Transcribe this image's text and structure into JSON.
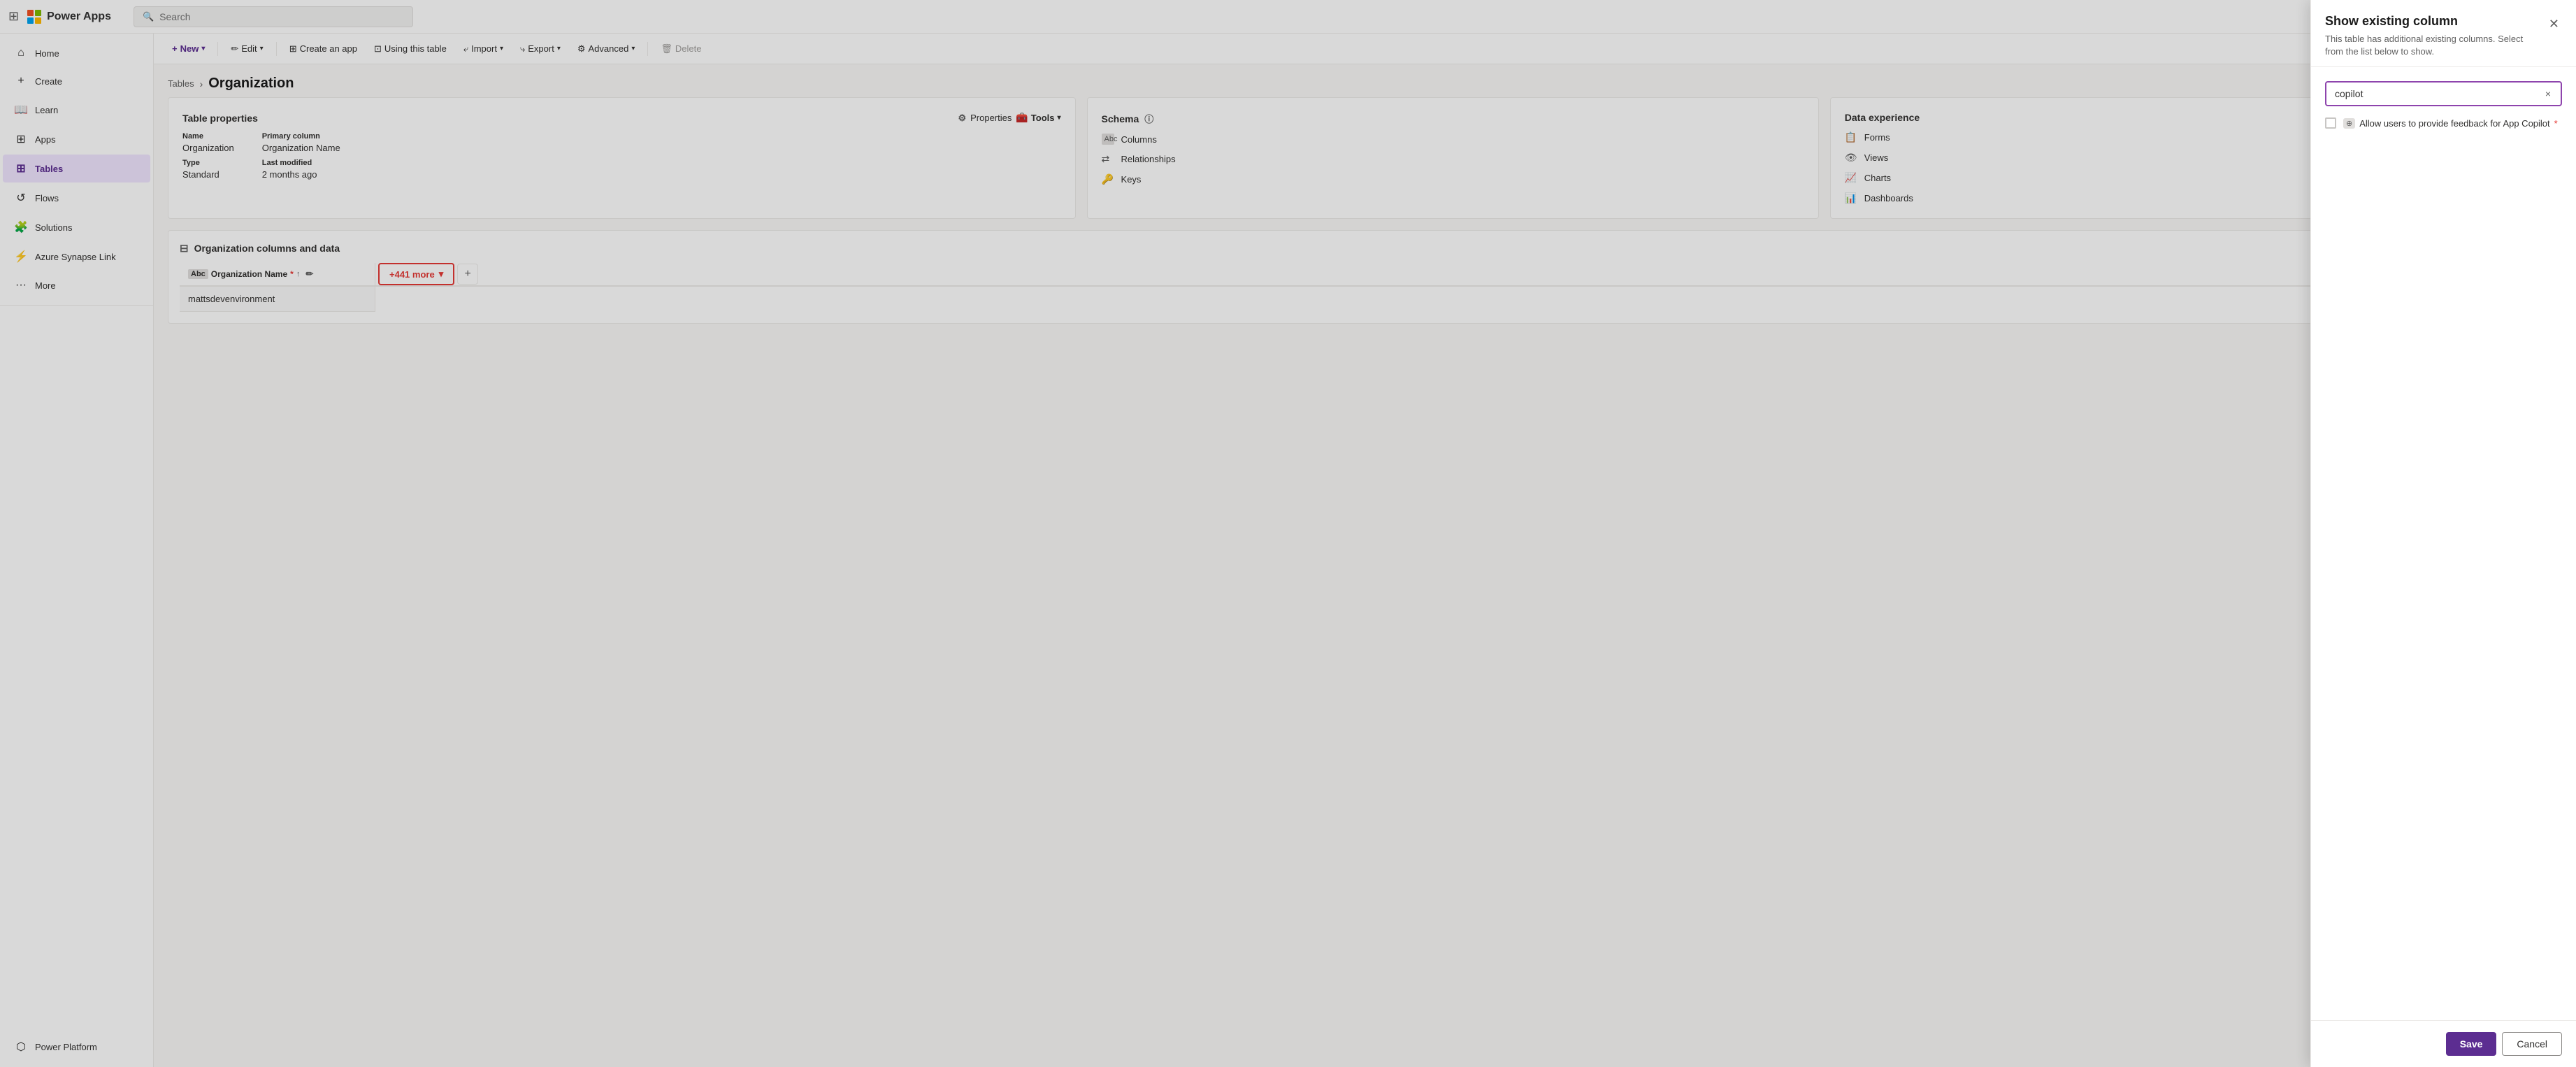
{
  "app": {
    "brand": "Power Apps",
    "search_placeholder": "Search"
  },
  "nav": {
    "items": [
      {
        "id": "home",
        "label": "Home",
        "icon": "⌂"
      },
      {
        "id": "create",
        "label": "Create",
        "icon": "+"
      },
      {
        "id": "learn",
        "label": "Learn",
        "icon": "📖"
      },
      {
        "id": "apps",
        "label": "Apps",
        "icon": "⊞"
      },
      {
        "id": "tables",
        "label": "Tables",
        "icon": "⊞",
        "active": true
      },
      {
        "id": "flows",
        "label": "Flows",
        "icon": "↺"
      },
      {
        "id": "solutions",
        "label": "Solutions",
        "icon": "🧩"
      },
      {
        "id": "azure-synapse",
        "label": "Azure Synapse Link",
        "icon": "⚡"
      },
      {
        "id": "more",
        "label": "More",
        "icon": "···"
      },
      {
        "id": "power-platform",
        "label": "Power Platform",
        "icon": "⬡"
      }
    ]
  },
  "toolbar": {
    "new_label": "New",
    "edit_label": "Edit",
    "create_app_label": "Create an app",
    "using_this_table_label": "Using this table",
    "import_label": "Import",
    "export_label": "Export",
    "advanced_label": "Advanced",
    "delete_label": "Delete"
  },
  "breadcrumb": {
    "parent_label": "Tables",
    "separator": "›",
    "current": "Organization"
  },
  "table_properties": {
    "title": "Table properties",
    "properties_label": "Properties",
    "tools_label": "Tools",
    "name_label": "Name",
    "name_value": "Organization",
    "type_label": "Type",
    "type_value": "Standard",
    "primary_column_label": "Primary column",
    "primary_column_value": "Organization Name",
    "last_modified_label": "Last modified",
    "last_modified_value": "2 months ago"
  },
  "schema": {
    "title": "Schema",
    "info_icon": "ⓘ",
    "items": [
      {
        "id": "columns",
        "label": "Columns",
        "icon": "Abc"
      },
      {
        "id": "relationships",
        "label": "Relationships",
        "icon": "⇄"
      },
      {
        "id": "keys",
        "label": "Keys",
        "icon": "🔑"
      }
    ]
  },
  "data_experience": {
    "title": "Data experience",
    "items": [
      {
        "id": "forms",
        "label": "Forms",
        "icon": "📋"
      },
      {
        "id": "views",
        "label": "Views",
        "icon": "👁"
      },
      {
        "id": "charts",
        "label": "Charts",
        "icon": "📈"
      },
      {
        "id": "dashboards",
        "label": "Dashboards",
        "icon": "📊"
      }
    ]
  },
  "columns_data": {
    "section_title": "Organization columns and data",
    "org_name_col": "Organization Name",
    "more_btn": "+441 more",
    "add_col_icon": "+",
    "row_value": "mattsdevenvironment"
  },
  "panel": {
    "title": "Show existing column",
    "subtitle": "This table has additional existing columns. Select from the list below to show.",
    "search_value": "copilot",
    "search_clear": "×",
    "checkbox_label": "Allow users to provide feedback for App Copilot",
    "tag_label": "⊕",
    "required_star": "*",
    "save_label": "Save",
    "cancel_label": "Cancel"
  }
}
